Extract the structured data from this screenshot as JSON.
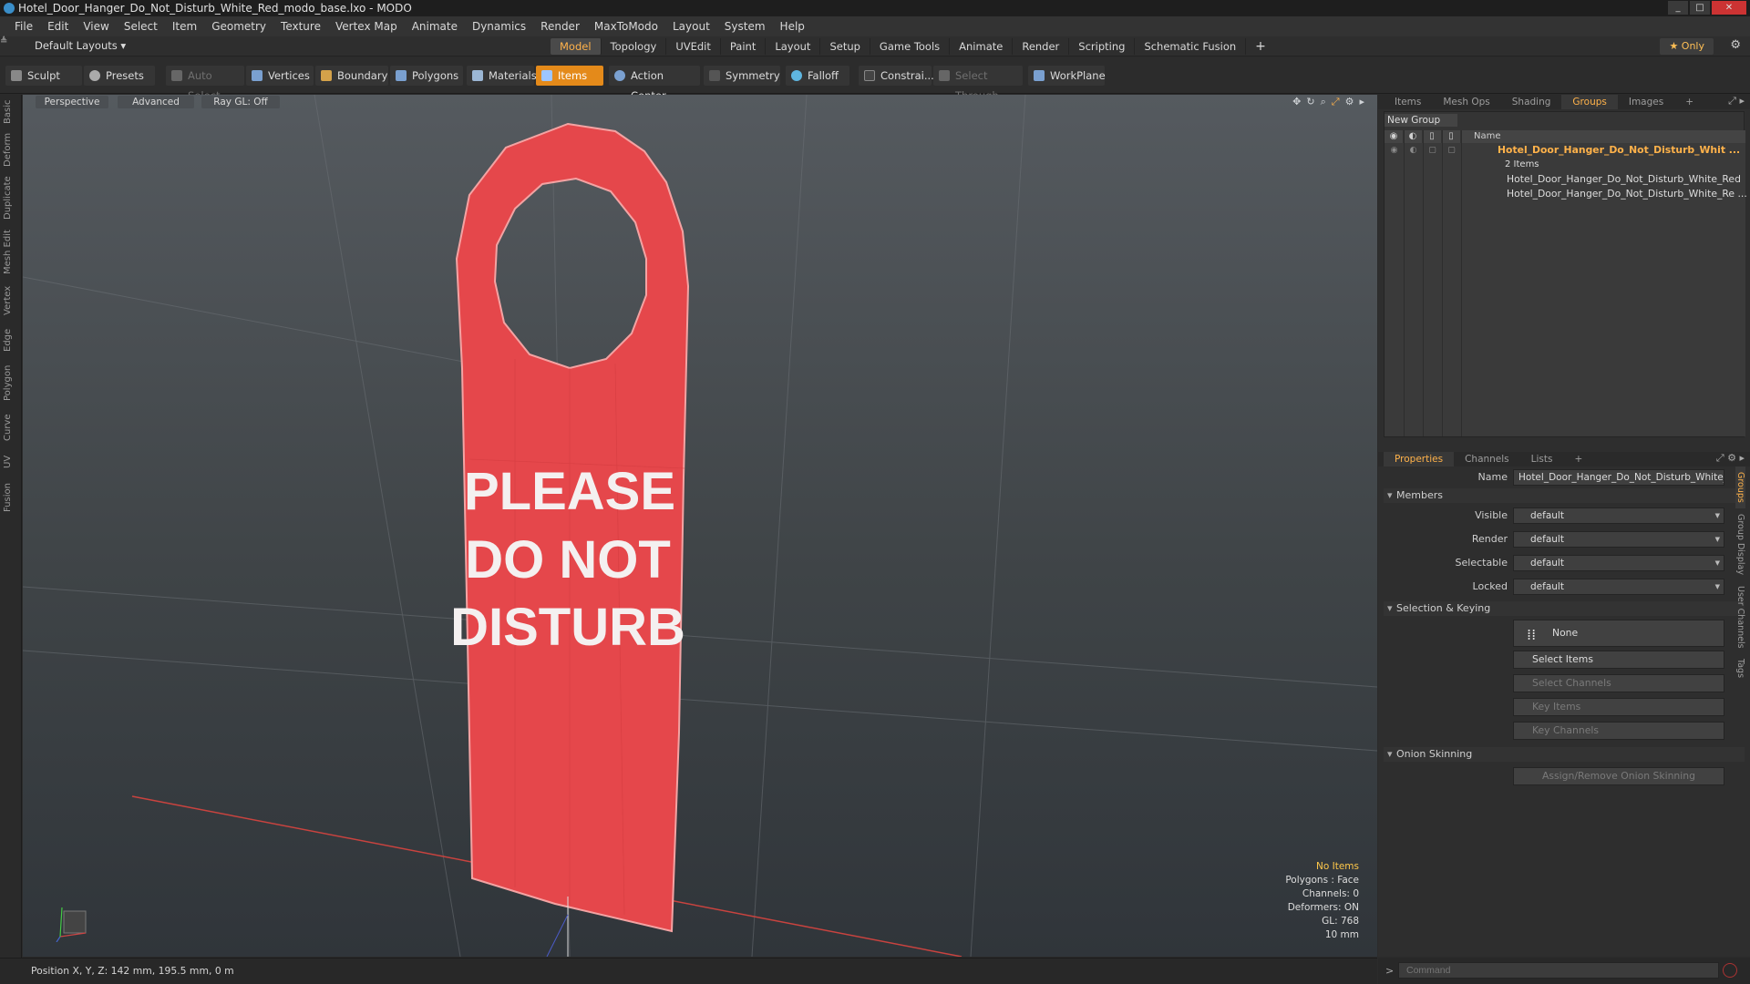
{
  "window": {
    "title": "Hotel_Door_Hanger_Do_Not_Disturb_White_Red_modo_base.lxo - MODO"
  },
  "menu": [
    "File",
    "Edit",
    "View",
    "Select",
    "Item",
    "Geometry",
    "Texture",
    "Vertex Map",
    "Animate",
    "Dynamics",
    "Render",
    "MaxToModo",
    "Layout",
    "System",
    "Help"
  ],
  "layout": {
    "dropdown": "Default Layouts ▾",
    "only_label": "★  Only",
    "plus": "+"
  },
  "mode_tabs": [
    "Model",
    "Topology",
    "UVEdit",
    "Paint",
    "Layout",
    "Setup",
    "Game Tools",
    "Animate",
    "Render",
    "Scripting",
    "Schematic Fusion"
  ],
  "toolbar": {
    "sculpt": "Sculpt",
    "presets": "Presets",
    "auto_select": "Auto Select",
    "vertices": "Vertices",
    "boundary": "Boundary",
    "polygons": "Polygons",
    "materials": "Materials",
    "items": "Items",
    "action_center": "Action Center",
    "symmetry": "Symmetry",
    "falloff": "Falloff",
    "constraints": "Constrai...",
    "select_through": "Select Through",
    "workplane": "WorkPlane"
  },
  "left_tabs": [
    "Basic",
    "Deform",
    "Duplicate",
    "Mesh Edit",
    "Vertex",
    "Edge",
    "Polygon",
    "Curve",
    "UV",
    "Fusion"
  ],
  "viewport": {
    "perspective": "Perspective",
    "advanced": "Advanced",
    "raygl": "Ray GL: Off",
    "hanger_text": [
      "PLEASE",
      "DO NOT",
      "DISTURB"
    ],
    "hud": {
      "no_items": "No Items",
      "polygons": "Polygons : Face",
      "channels": "Channels: 0",
      "deformers": "Deformers: ON",
      "gl": "GL: 768",
      "scale": "10 mm"
    }
  },
  "colors": {
    "hanger": "#e5474b",
    "accent": "#ffb24a"
  },
  "top_panel": {
    "tabs": [
      "Items",
      "Mesh Ops",
      "Shading",
      "Groups",
      "Images"
    ],
    "new_group": "New Group",
    "col_name": "Name",
    "group_title": "Hotel_Door_Hanger_Do_Not_Disturb_Whit ...",
    "group_count": "2 Items",
    "items": [
      "Hotel_Door_Hanger_Do_Not_Disturb_White_Red",
      "Hotel_Door_Hanger_Do_Not_Disturb_White_Re ..."
    ]
  },
  "properties": {
    "tabs": [
      "Properties",
      "Channels",
      "Lists"
    ],
    "name_label": "Name",
    "name_value": "Hotel_Door_Hanger_Do_Not_Disturb_White_F",
    "members_hdr": "Members",
    "visible_label": "Visible",
    "visible_value": "default",
    "render_label": "Render",
    "render_value": "default",
    "selectable_label": "Selectable",
    "selectable_value": "default",
    "locked_label": "Locked",
    "locked_value": "default",
    "selection_hdr": "Selection & Keying",
    "none_btn": "None",
    "select_items": "Select Items",
    "select_channels": "Select Channels",
    "key_items": "Key Items",
    "key_channels": "Key Channels",
    "onion_hdr": "Onion Skinning",
    "onion_btn": "Assign/Remove Onion Skinning"
  },
  "right_vtabs": [
    "Groups",
    "Group Display",
    "User Channels",
    "Tags"
  ],
  "status": {
    "position": "Position X, Y, Z:  142 mm, 195.5 mm, 0 m"
  },
  "command": {
    "placeholder": "Command"
  }
}
